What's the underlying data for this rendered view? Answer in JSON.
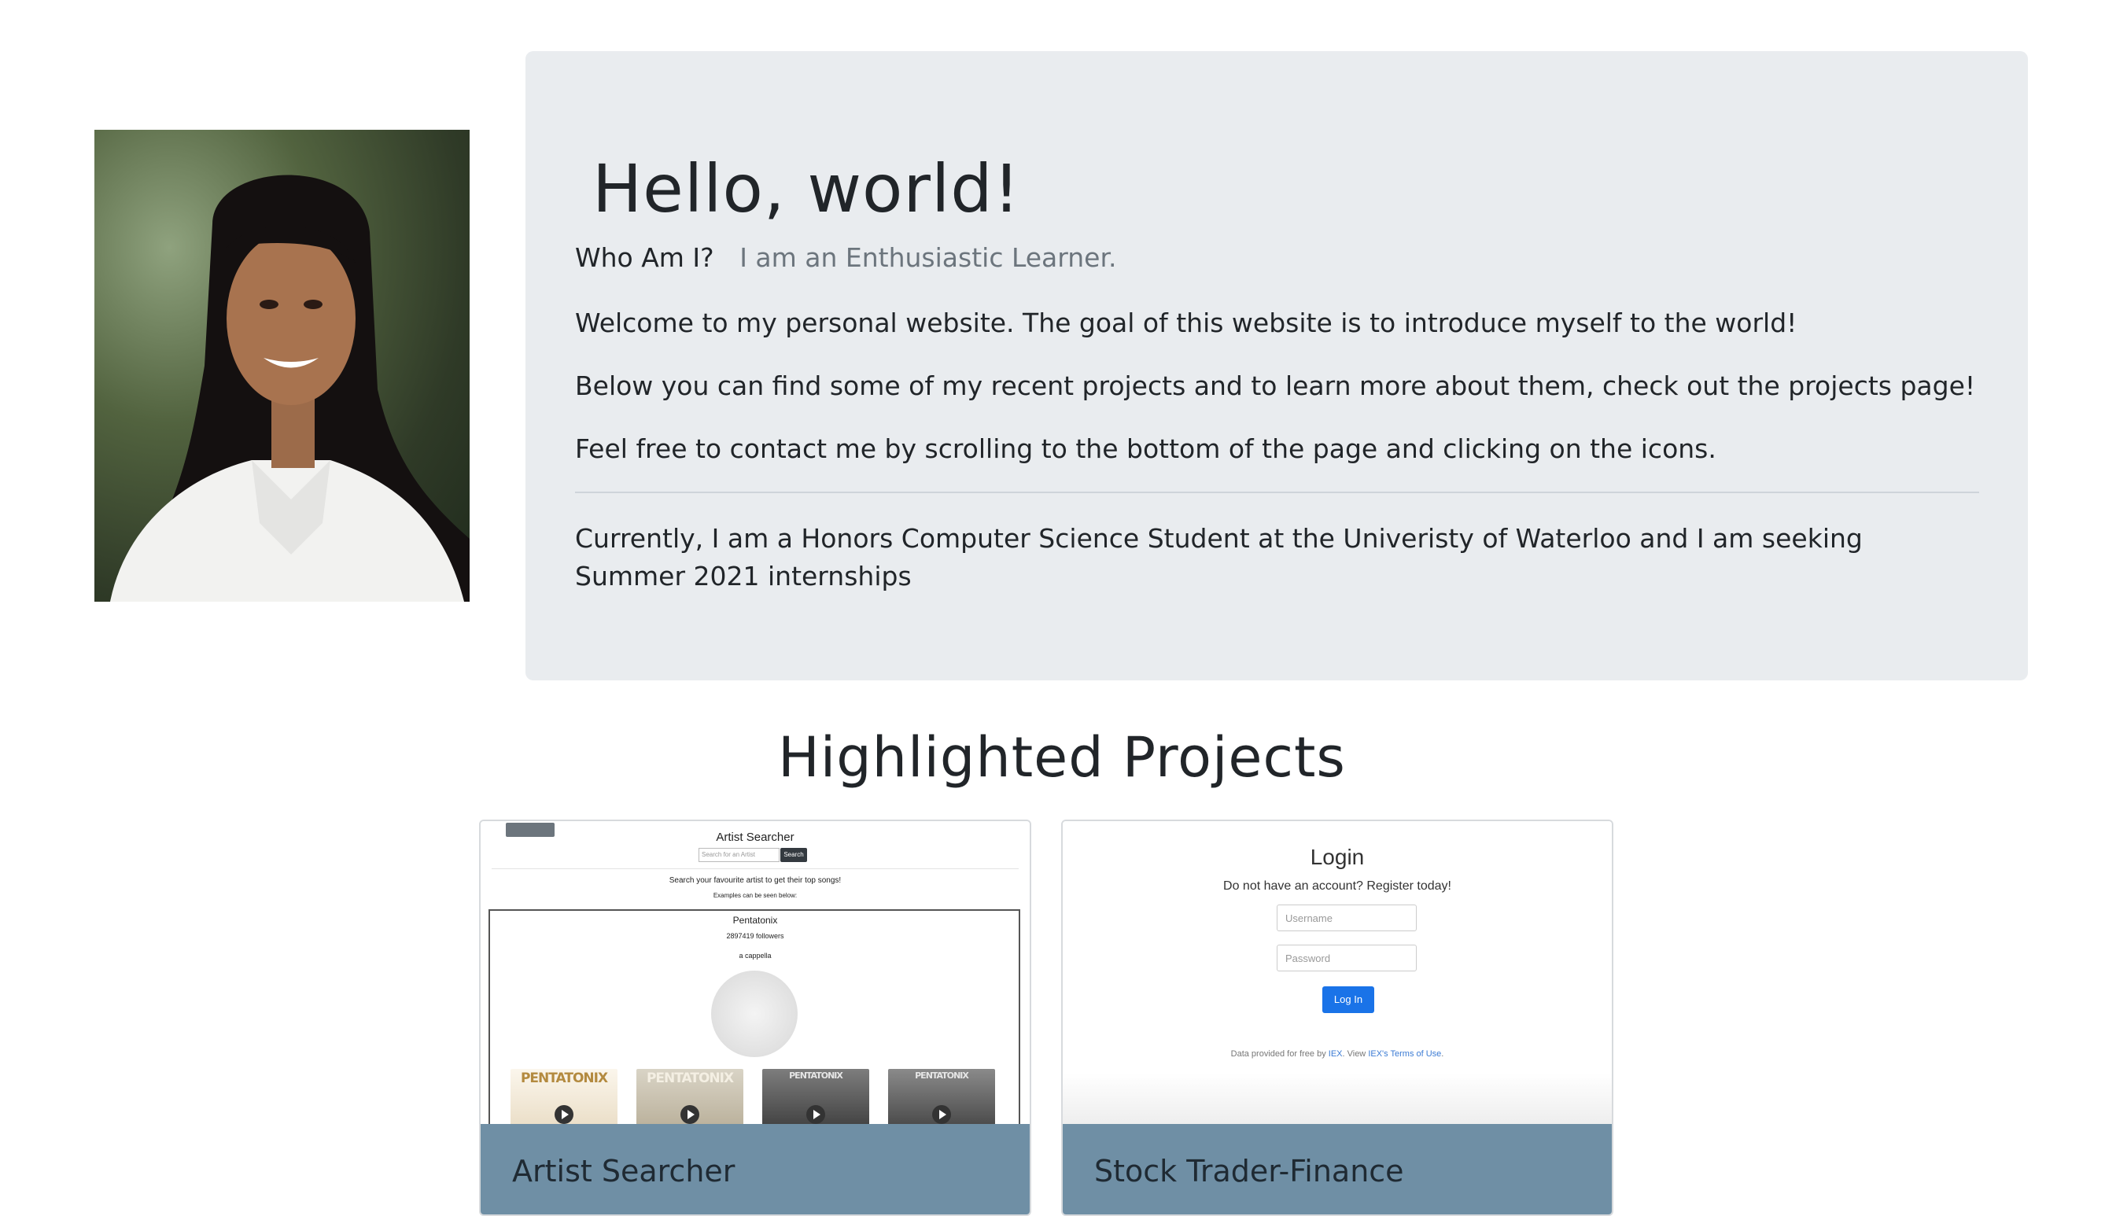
{
  "profile": {
    "photo_alt": "profile-photo"
  },
  "jumbotron": {
    "heading": "Hello, world!",
    "who_label": "Who Am I?",
    "who_value": "I am an Enthusiastic Learner.",
    "paragraph_1": "Welcome to my personal website. The goal of this website is to introduce myself to the world!",
    "paragraph_2": "Below you can find some of my recent projects and to learn more about them, check out the projects page!",
    "paragraph_3": "Feel free to contact me by scrolling to the bottom of the page and clicking on the icons.",
    "paragraph_4": "Currently, I am a Honors Computer Science Student at the Univeristy of Waterloo and I am seeking Summer 2021 internships"
  },
  "projects": {
    "section_title": "Highlighted Projects",
    "cards": [
      {
        "title": "Artist Searcher",
        "preview": {
          "app_title": "Artist Searcher",
          "search_placeholder": "Search for an Artist",
          "search_button": "Search",
          "subtitle": "Search your favourite artist to get their top songs!",
          "examples": "Examples can be seen below:",
          "artist_name": "Pentatonix",
          "followers": "2897419 followers",
          "genre": "a cappella",
          "albums": [
            "PENTATONIX",
            "PENTATONIX",
            "PENTATONIX",
            "PENTATONIX"
          ]
        }
      },
      {
        "title": "Stock Trader-Finance",
        "preview": {
          "heading": "Login",
          "register_text": "Do not have an account? Register today!",
          "username_placeholder": "Username",
          "password_placeholder": "Password",
          "login_button": "Log In",
          "footer_prefix": "Data provided for free by ",
          "footer_link_1": "IEX",
          "footer_mid": ". View ",
          "footer_link_2": "IEX's Terms of Use",
          "footer_suffix": "."
        }
      }
    ]
  },
  "colors": {
    "jumbotron_bg": "#e9ecef",
    "card_footer_bg": "#6f8fa5",
    "muted_text": "#6c757d",
    "login_button": "#1a73e8"
  }
}
